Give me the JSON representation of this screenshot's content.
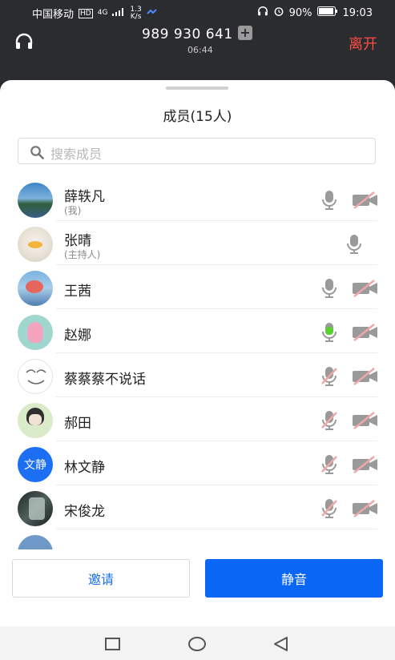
{
  "status_bar": {
    "carrier": "中国移动",
    "hd": "HD",
    "network": "4G",
    "speed_top": "1.3",
    "speed_unit": "K/s",
    "battery": "90%",
    "time": "19:03"
  },
  "call": {
    "number": "989 930 641",
    "duration": "06:44",
    "leave_label": "离开"
  },
  "members_panel": {
    "title": "成员(15人)",
    "search_placeholder": "搜索成员",
    "members": [
      {
        "name": "薛轶凡",
        "sub": "(我)",
        "mic": "gray",
        "video": "off",
        "avatar": "landscape-photo"
      },
      {
        "name": "张晴",
        "sub": "(主持人)",
        "mic": "gray",
        "video": "none",
        "avatar": "duck-photo"
      },
      {
        "name": "王茜",
        "sub": "",
        "mic": "gray",
        "video": "off",
        "avatar": "fish-photo"
      },
      {
        "name": "赵娜",
        "sub": "",
        "mic": "green",
        "video": "off",
        "avatar": "peppa-photo"
      },
      {
        "name": "蔡蔡蔡不说话",
        "sub": "",
        "mic": "muted",
        "video": "off",
        "avatar": "sketch-photo"
      },
      {
        "name": "郝田",
        "sub": "",
        "mic": "muted",
        "video": "off",
        "avatar": "anime-girl-photo"
      },
      {
        "name": "林文静",
        "sub": "",
        "mic": "muted",
        "video": "off",
        "avatar": "text-avatar",
        "avatar_text": "文静"
      },
      {
        "name": "宋俊龙",
        "sub": "",
        "mic": "muted",
        "video": "off",
        "avatar": "dark-photo"
      }
    ]
  },
  "actions": {
    "invite_label": "邀请",
    "mute_label": "静音"
  },
  "colors": {
    "accent": "#0a66f5",
    "leave": "#ff4b44",
    "mic_active": "#5ccf32",
    "muted": "#f0a7a7"
  }
}
